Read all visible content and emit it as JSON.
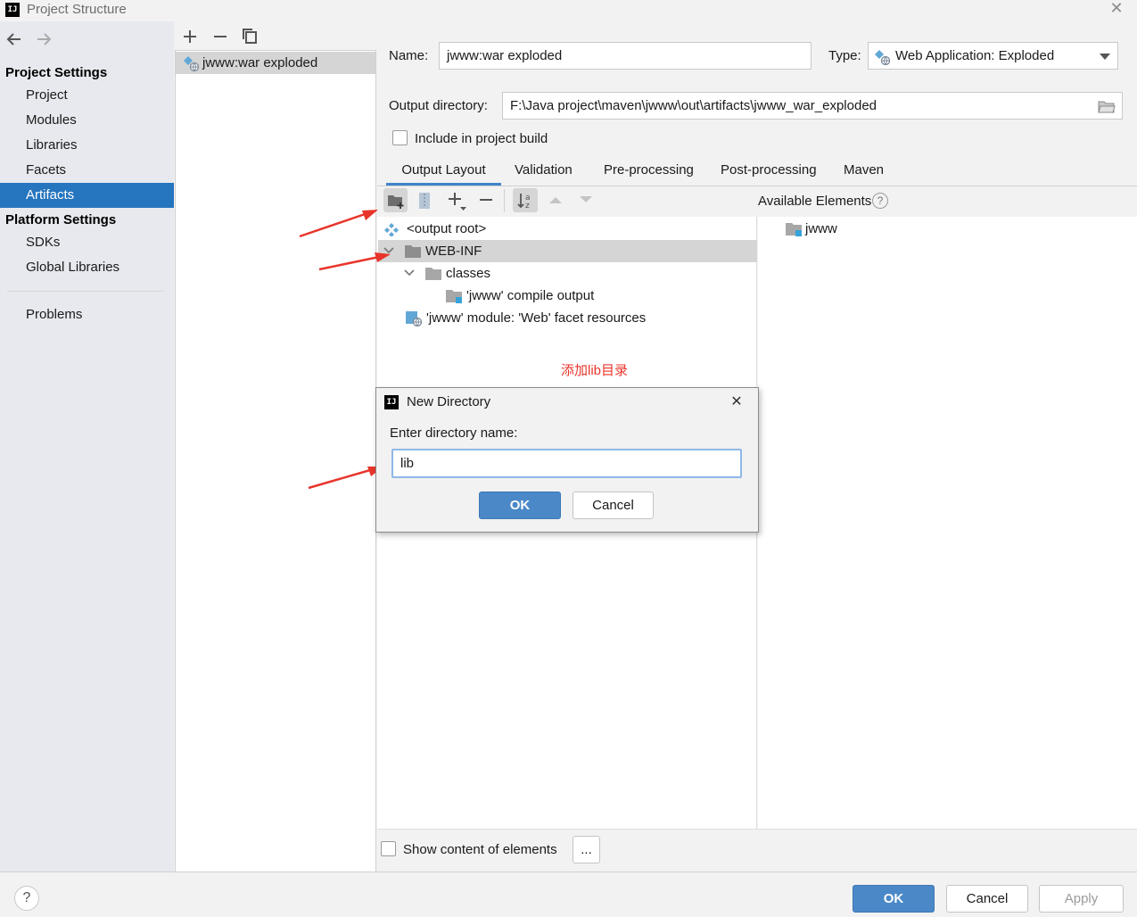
{
  "window": {
    "title": "Project Structure",
    "app_icon_text": "IJ"
  },
  "nav": {
    "project_settings_header": "Project Settings",
    "project_items": [
      "Project",
      "Modules",
      "Libraries",
      "Facets",
      "Artifacts"
    ],
    "selected": "Artifacts",
    "platform_settings_header": "Platform Settings",
    "platform_items": [
      "SDKs",
      "Global Libraries"
    ],
    "problems": "Problems"
  },
  "artifacts_list": {
    "items": [
      "jwww:war exploded"
    ],
    "selected": "jwww:war exploded"
  },
  "form": {
    "name_label": "Name:",
    "name_value": "jwww:war exploded",
    "type_label": "Type:",
    "type_value": "Web Application: Exploded",
    "output_dir_label": "Output directory:",
    "output_dir_value": "F:\\Java project\\maven\\jwww\\out\\artifacts\\jwww_war_exploded",
    "include_build_label": "Include in project build",
    "include_build_checked": false
  },
  "tabs": [
    "Output Layout",
    "Validation",
    "Pre-processing",
    "Post-processing",
    "Maven"
  ],
  "active_tab": "Output Layout",
  "layout_tree": {
    "rows": [
      "<output root>",
      "WEB-INF",
      "classes",
      "'jwww' compile output",
      "'jwww' module: 'Web' facet resources"
    ]
  },
  "available": {
    "title": "Available Elements",
    "items": [
      "jwww"
    ]
  },
  "annotation": "添加lib目录",
  "dialog": {
    "title": "New Directory",
    "prompt": "Enter directory name:",
    "value": "lib",
    "ok": "OK",
    "cancel": "Cancel"
  },
  "show_content": {
    "label": "Show content of elements",
    "checked": false,
    "more_button": "..."
  },
  "footer": {
    "help": "?",
    "ok": "OK",
    "cancel": "Cancel",
    "apply": "Apply"
  },
  "colors": {
    "selection": "#2675bf",
    "primary_button": "#4a88c7",
    "annotation": "#e8352b"
  }
}
